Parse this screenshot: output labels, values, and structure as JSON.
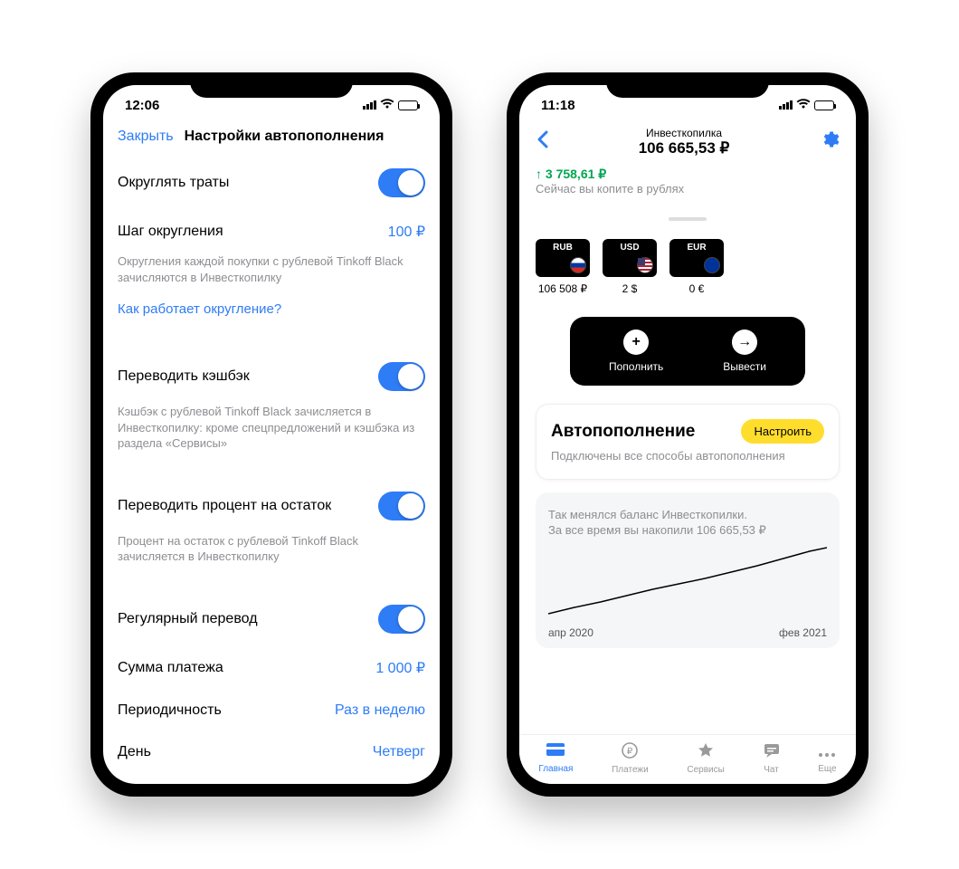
{
  "phone1": {
    "status_time": "12:06",
    "close_label": "Закрыть",
    "title": "Настройки автопополнения",
    "rounding": {
      "label": "Округлять траты",
      "step_label": "Шаг округления",
      "step_value": "100 ₽",
      "desc": "Округления каждой покупки с рублевой Tinkoff Black зачисляются в Инвесткопилку",
      "link": "Как работает округление?"
    },
    "cashback": {
      "label": "Переводить кэшбэк",
      "desc": "Кэшбэк с рублевой Tinkoff Black зачисляется в Инвесткопилку: кроме спецпредложений и кэшбэка из раздела «Сервисы»"
    },
    "interest": {
      "label": "Переводить процент на остаток",
      "desc": "Процент на остаток с рублевой Tinkoff Black зачисляется в Инвесткопилку"
    },
    "regular": {
      "label": "Регулярный перевод",
      "amount_label": "Сумма платежа",
      "amount_value": "1 000 ₽",
      "period_label": "Периодичность",
      "period_value": "Раз в неделю",
      "day_label": "День",
      "day_value": "Четверг"
    }
  },
  "phone2": {
    "status_time": "11:18",
    "header_sub": "Инвесткопилка",
    "header_main": "106 665,53 ₽",
    "profit": "↑ 3 758,61 ₽",
    "profit_sub": "Сейчас вы копите в рублях",
    "currencies": [
      {
        "code": "RUB",
        "value": "106 508 ₽"
      },
      {
        "code": "USD",
        "value": "2 $"
      },
      {
        "code": "EUR",
        "value": "0 €"
      }
    ],
    "actions": {
      "deposit": "Пополнить",
      "withdraw": "Вывести"
    },
    "auto": {
      "title": "Автопополнение",
      "chip": "Настроить",
      "sub": "Подключены все способы автопополнения"
    },
    "chart": {
      "text1": "Так менялся баланс Инвесткопилки.",
      "text2": "За все время вы накопили 106 665,53 ₽",
      "date_from": "апр 2020",
      "date_to": "фев 2021"
    },
    "tabs": {
      "home": "Главная",
      "payments": "Платежи",
      "services": "Сервисы",
      "chat": "Чат",
      "more": "Еще"
    }
  },
  "chart_data": {
    "type": "line",
    "title": "Баланс Инвесткопилки",
    "x_range": [
      "апр 2020",
      "фев 2021"
    ],
    "ylim": [
      0,
      110000
    ],
    "points": [
      {
        "x": "апр 2020",
        "y": 0
      },
      {
        "x": "май 2020",
        "y": 9000
      },
      {
        "x": "июн 2020",
        "y": 18000
      },
      {
        "x": "июл 2020",
        "y": 28000
      },
      {
        "x": "авг 2020",
        "y": 38000
      },
      {
        "x": "сен 2020",
        "y": 47000
      },
      {
        "x": "окт 2020",
        "y": 56000
      },
      {
        "x": "ноя 2020",
        "y": 66000
      },
      {
        "x": "дек 2020",
        "y": 78000
      },
      {
        "x": "янв 2021",
        "y": 92000
      },
      {
        "x": "фев 2021",
        "y": 106665
      }
    ]
  }
}
